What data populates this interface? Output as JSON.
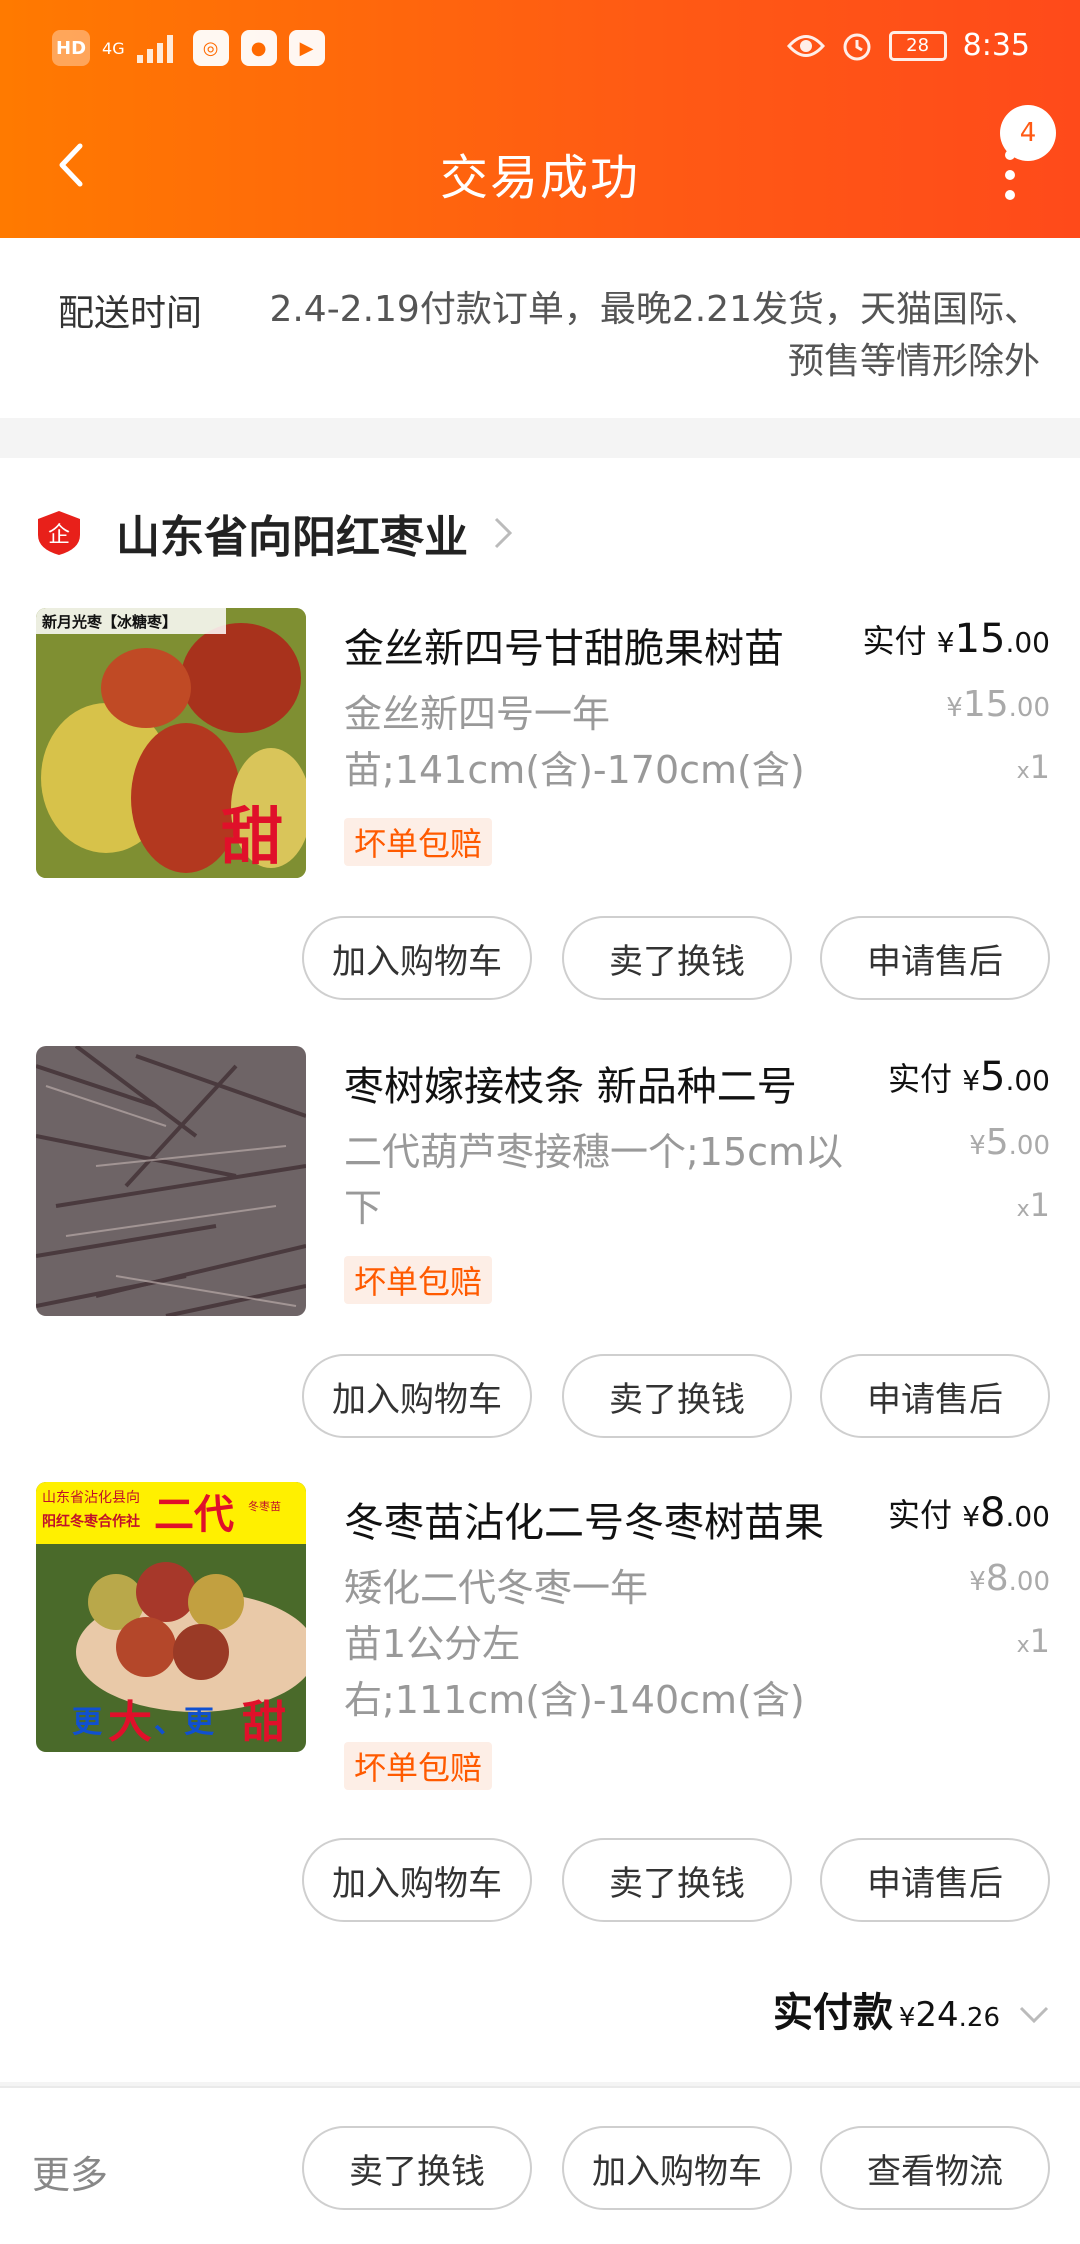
{
  "status_bar": {
    "left_labels": [
      "HD",
      "4G"
    ],
    "battery": "28",
    "time": "8:35"
  },
  "nav": {
    "title": "交易成功",
    "badge_count": "4"
  },
  "delivery": {
    "label": "配送时间",
    "text": "2.4-2.19付款订单，最晚2.21发货，天猫国际、预售等情形除外"
  },
  "shop": {
    "logo_text": "企",
    "name": "山东省向阳红枣业"
  },
  "items": [
    {
      "title": "金丝新四号甘甜脆果树苗",
      "spec": "金丝新四号一年苗;141cm(含)-170cm(含)",
      "tag": "坏单包赔",
      "paid_label": "实付",
      "currency": "¥",
      "paid_int": "15",
      "paid_dec": ".00",
      "orig_int": "15",
      "orig_dec": ".00",
      "qty_x": "x",
      "qty": "1",
      "thumb_caption": "新月光枣【冰糖枣】",
      "thumb_overlay": "甜",
      "buttons": [
        "加入购物车",
        "卖了换钱",
        "申请售后"
      ]
    },
    {
      "title": "枣树嫁接枝条 新品种二号",
      "spec": "二代葫芦枣接穗一个;15cm以下",
      "tag": "坏单包赔",
      "paid_label": "实付",
      "currency": "¥",
      "paid_int": "5",
      "paid_dec": ".00",
      "orig_int": "5",
      "orig_dec": ".00",
      "qty_x": "x",
      "qty": "1",
      "buttons": [
        "加入购物车",
        "卖了换钱",
        "申请售后"
      ]
    },
    {
      "title": "冬枣苗沾化二号冬枣树苗果",
      "spec": "矮化二代冬枣一年苗1公分左右;111cm(含)-140cm(含)",
      "tag": "坏单包赔",
      "paid_label": "实付",
      "currency": "¥",
      "paid_int": "8",
      "paid_dec": ".00",
      "orig_int": "8",
      "orig_dec": ".00",
      "qty_x": "x",
      "qty": "1",
      "thumb_caption_1": "山东省沾化县向",
      "thumb_caption_2": "阳红冬枣合作社",
      "thumb_big": "二代",
      "thumb_small": "冬枣苗",
      "thumb_bottom_1": "更",
      "thumb_bottom_2": "大",
      "thumb_bottom_3": "、更",
      "thumb_bottom_4": "甜",
      "buttons": [
        "加入购物车",
        "卖了换钱",
        "申请售后"
      ]
    }
  ],
  "total": {
    "label": "实付款",
    "currency": "¥",
    "int": "24",
    "dec": ".26"
  },
  "bottom_bar": {
    "more": "更多",
    "buttons": [
      "卖了换钱",
      "加入购物车",
      "查看物流"
    ]
  },
  "colors": {
    "header_start": "#ff7a00",
    "header_end": "#ff4a1a",
    "tag_bg": "#fdeee6",
    "tag_text": "#ff5a00"
  },
  "icons": [
    "back-icon",
    "more-icon",
    "shop-logo-icon",
    "chevron-right-icon",
    "chevron-down-icon",
    "eye-icon",
    "alarm-icon",
    "battery-icon",
    "signal-icon"
  ]
}
